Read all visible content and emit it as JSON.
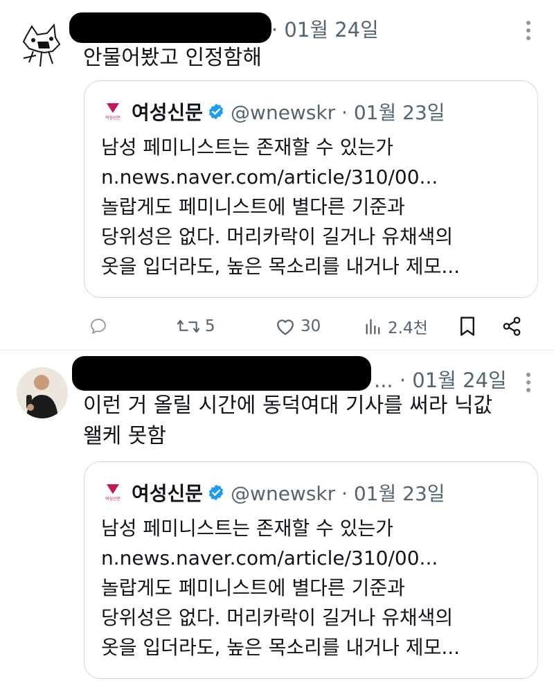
{
  "tweets": [
    {
      "date": "· 01월 24일",
      "text_lines": [
        "안물어봤고 인정함해"
      ],
      "quote": {
        "logo_caption": "여성신문",
        "name": "여성신문",
        "handle_date": "@wnewskr · 01월 23일",
        "body": "남성 페미니스트는 존재할 수 있는가\nn.news.naver.com/article/310/00...\n놀랍게도 페미니스트에 별다른 기준과\n당위성은 없다. 머리카락이 길거나 유채색의\n옷을 입더라도, 높은 목소리를 내거나 제모..."
      },
      "actions": {
        "reply_count": "",
        "retweet_count": "5",
        "like_count": "30",
        "views_count": "2.4천"
      }
    },
    {
      "date": "... · 01월 24일",
      "text_lines": [
        "이런 거 올릴 시간에 동덕여대 기사를 써라 닉값",
        "왤케 못함"
      ],
      "quote": {
        "logo_caption": "여성신문",
        "name": "여성신문",
        "handle_date": "@wnewskr · 01월 23일",
        "body": "남성 페미니스트는 존재할 수 있는가\nn.news.naver.com/article/310/00...\n놀랍게도 페미니스트에 별다른 기준과\n당위성은 없다. 머리카락이 길거나 유채색의\n옷을 입더라도, 높은 목소리를 내거나 제모..."
      }
    }
  ],
  "icons": {
    "verified": "verified-badge-icon",
    "reply": "reply-icon",
    "retweet": "retweet-icon",
    "like": "heart-icon",
    "views": "views-icon",
    "bookmark": "bookmark-icon",
    "share": "share-icon",
    "more": "more-vertical-icon"
  },
  "colors": {
    "text": "#0f1419",
    "secondary": "#536471",
    "verified": "#1d9bf0",
    "border": "#cfd9de",
    "logo": "#c2185b"
  }
}
